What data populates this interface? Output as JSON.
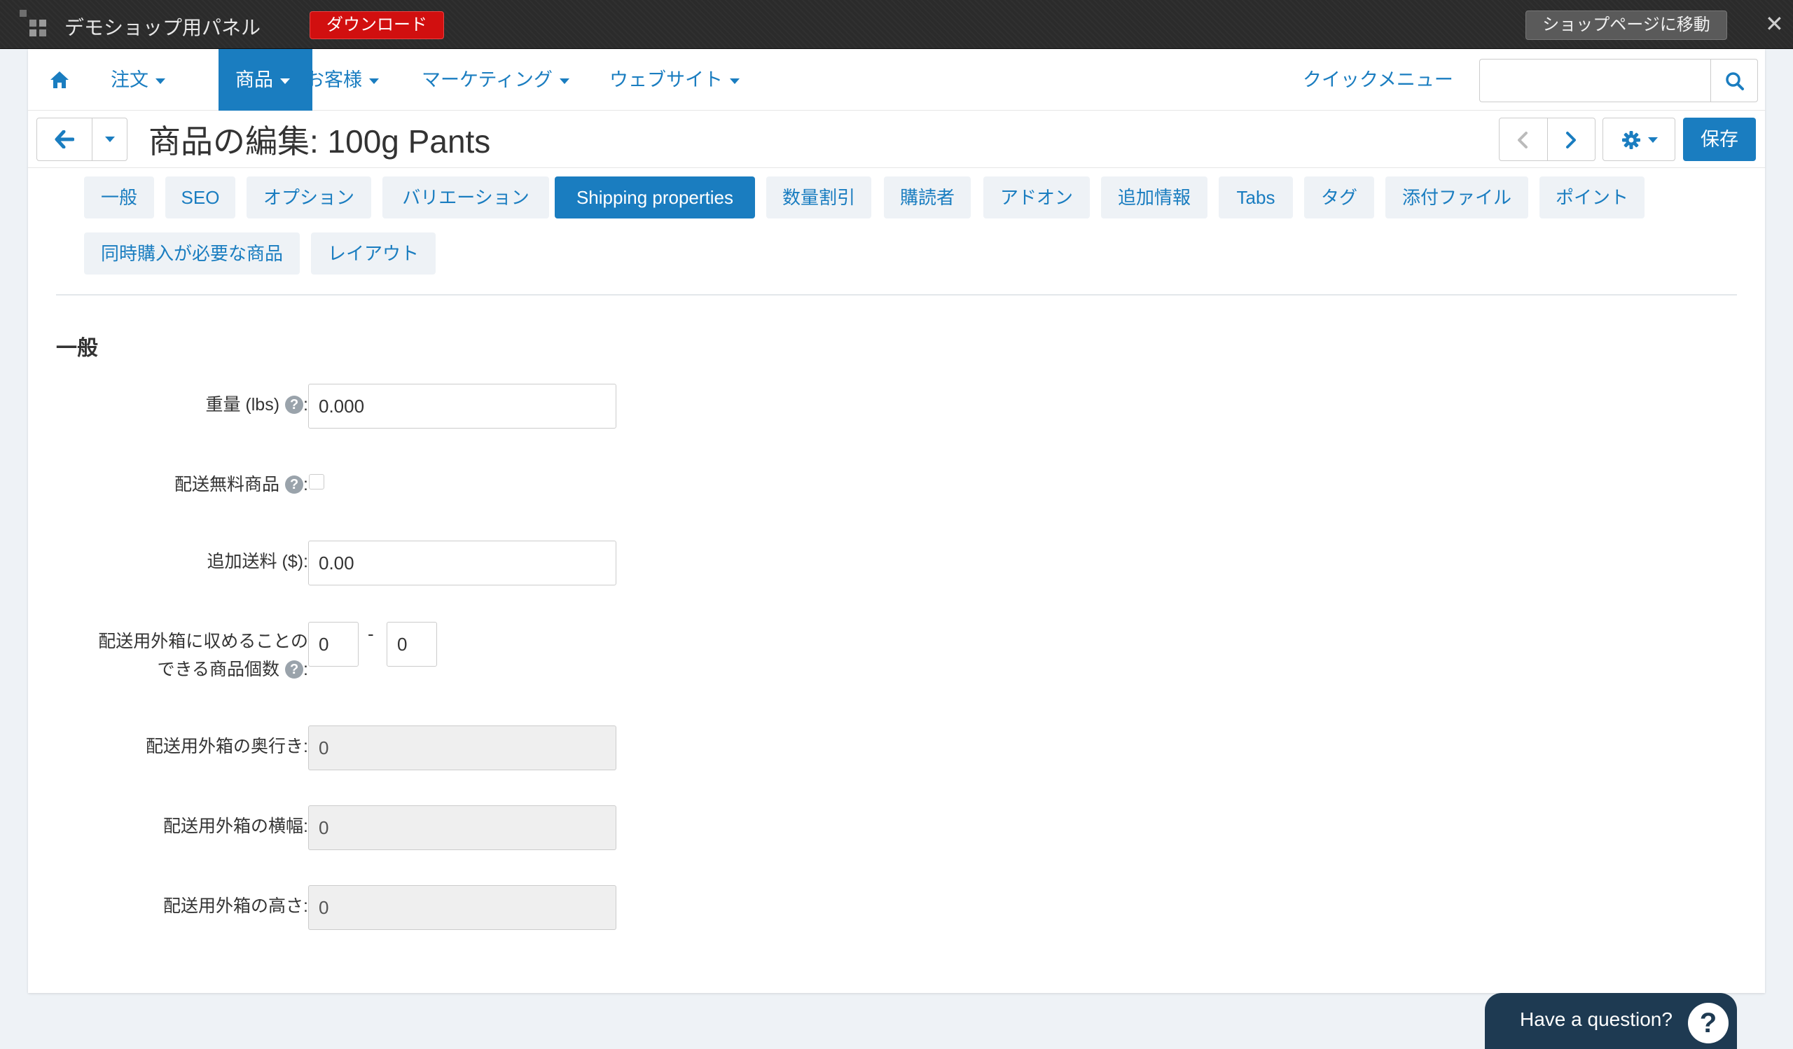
{
  "demo_bar": {
    "title": "デモショップ用パネル",
    "download_label": "ダウンロード",
    "shop_page_label": "ショップページに移動",
    "close_glyph": "✕"
  },
  "nav": {
    "items": [
      {
        "label": "注文"
      },
      {
        "label": "商品"
      },
      {
        "label": "お客様"
      },
      {
        "label": "マーケティング"
      },
      {
        "label": "ウェブサイト"
      }
    ],
    "quick_menu": "クイックメニュー",
    "search_placeholder": ""
  },
  "header": {
    "title": "商品の編集: 100g Pants",
    "save_label": "保存"
  },
  "tabs": [
    {
      "label": "一般"
    },
    {
      "label": "SEO"
    },
    {
      "label": "オプション"
    },
    {
      "label": "バリエーション"
    },
    {
      "label": "Shipping properties"
    },
    {
      "label": "数量割引"
    },
    {
      "label": "購読者"
    },
    {
      "label": "アドオン"
    },
    {
      "label": "追加情報"
    },
    {
      "label": "Tabs"
    },
    {
      "label": "タグ"
    },
    {
      "label": "添付ファイル"
    },
    {
      "label": "ポイント"
    },
    {
      "label": "同時購入が必要な商品"
    },
    {
      "label": "レイアウト"
    }
  ],
  "form": {
    "section_title": "一般",
    "weight": {
      "label": "重量 (lbs)",
      "value": "0.000"
    },
    "free_shipping": {
      "label": "配送無料商品",
      "checked": false
    },
    "shipping_freight": {
      "label": "追加送料 ($):",
      "value": "0.00"
    },
    "items_in_box": {
      "label_line1": "配送用外箱に収めることの",
      "label_line2": "できる商品個数",
      "min": "0",
      "max": "0",
      "separator": "-"
    },
    "box_length": {
      "label": "配送用外箱の奥行き:",
      "value": "0"
    },
    "box_width": {
      "label": "配送用外箱の横幅:",
      "value": "0"
    },
    "box_height": {
      "label": "配送用外箱の高さ:",
      "value": "0"
    }
  },
  "help_widget": {
    "label": "Have a question?",
    "icon": "?"
  },
  "colors": {
    "accent": "#1a7dc0",
    "download": "#d10f0f",
    "help_widget": "#1e3a52"
  },
  "icons": {
    "home": "home-icon",
    "search": "search-icon",
    "back": "arrow-left-icon",
    "prev": "chevron-left-icon",
    "next": "chevron-right-icon",
    "settings": "gear-icon",
    "help": "question-circle-icon"
  }
}
